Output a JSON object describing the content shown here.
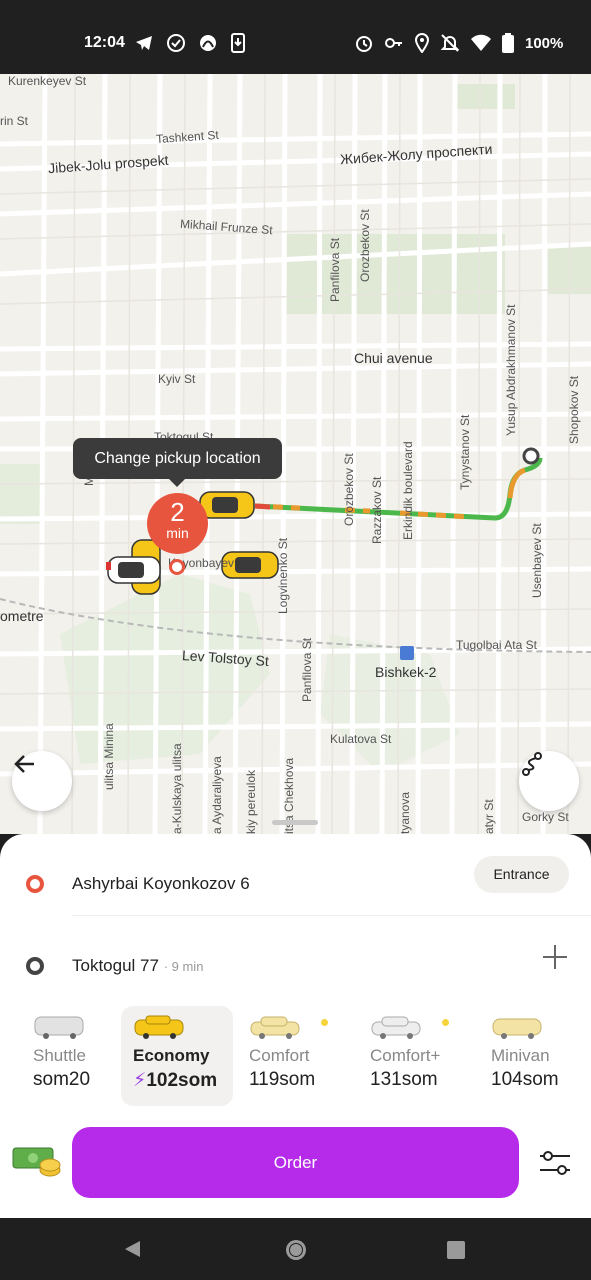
{
  "status_bar": {
    "time": "12:04",
    "battery": "100%",
    "icons": [
      "telegram-icon",
      "check-circle-icon",
      "app-icon",
      "download-icon",
      "alarm-icon",
      "key-icon",
      "location-icon",
      "bell-off-icon",
      "wifi-icon",
      "battery-icon"
    ]
  },
  "map": {
    "labels": {
      "kurenkeyev": "Kurenkeyev St",
      "rin": "rin St",
      "tashkent": "Tashkent St",
      "jibek_jolu": "Jibek-Jolu prospekt",
      "jibek_jolu_ru": "Жибек-Жолу проспекти",
      "mikhail_frunze": "Mikhail Frunze St",
      "panfilova": "Panfilova St",
      "orozbekov": "Orozbekov St",
      "yusup": "Yusup Abdrakhmanov St",
      "shopokov": "Shopokov St",
      "chui": "Chui avenue",
      "kyiv": "Kyiv St",
      "toktogul": "Toktogul St",
      "manas": "Manas",
      "tynystanov": "Tynystanov St",
      "ozbekov": "Orozbekov St",
      "razzakov": "Razzakov St",
      "erkindik": "Erkindik boulevard",
      "logvinenko": "Logvinenko St",
      "usenbayev": "Usenbayev St",
      "koyonbayev": "Koyonbayev",
      "metre": "ometre",
      "tugolbai": "Tugolbai Ata St",
      "lev_tolstoy": "Lev Tolstoy St",
      "bishkek2": "Bishkek-2",
      "panfilova2": "Panfilova St",
      "kulatova": "Kulatova St",
      "minina": "ulitsa Minina",
      "kulskaya": "a-Kulskaya ulitsa",
      "aydaraliyeva": "a Aydaraliyeva",
      "pereulok": "kiy pereulok",
      "chekhova": "itsa Chekhova",
      "tyanova": "tyanova",
      "atyr": "atyr St",
      "gorky": "Gorky St"
    },
    "tooltip": "Change pickup location",
    "eta_value": "2",
    "eta_unit": "min",
    "back_button_icon": "arrow-left-icon",
    "route_button_icon": "route-icon"
  },
  "route": {
    "from": "Ashyrbai Koyonkozov 6",
    "entrance_label": "Entrance",
    "to": "Toktogul 77",
    "to_time": "· 9 min"
  },
  "tariffs": [
    {
      "name": "Shuttle",
      "price": "som20",
      "selected": false,
      "badge": false
    },
    {
      "name": "Economy",
      "price": "102som",
      "selected": true,
      "badge": false,
      "surge_icon": "lightning-icon"
    },
    {
      "name": "Comfort",
      "price": "119som",
      "selected": false,
      "badge": true
    },
    {
      "name": "Comfort+",
      "price": "131som",
      "selected": false,
      "badge": true
    },
    {
      "name": "Minivan",
      "price": "104som",
      "selected": false,
      "badge": false
    }
  ],
  "order": {
    "button_label": "Order",
    "payment_icon": "cash-icon",
    "settings_icon": "sliders-icon"
  },
  "colors": {
    "accent": "#b62bea",
    "pickup": "#e8553e",
    "route_green": "#4cb84c",
    "taxi_yellow": "#f5c518"
  }
}
